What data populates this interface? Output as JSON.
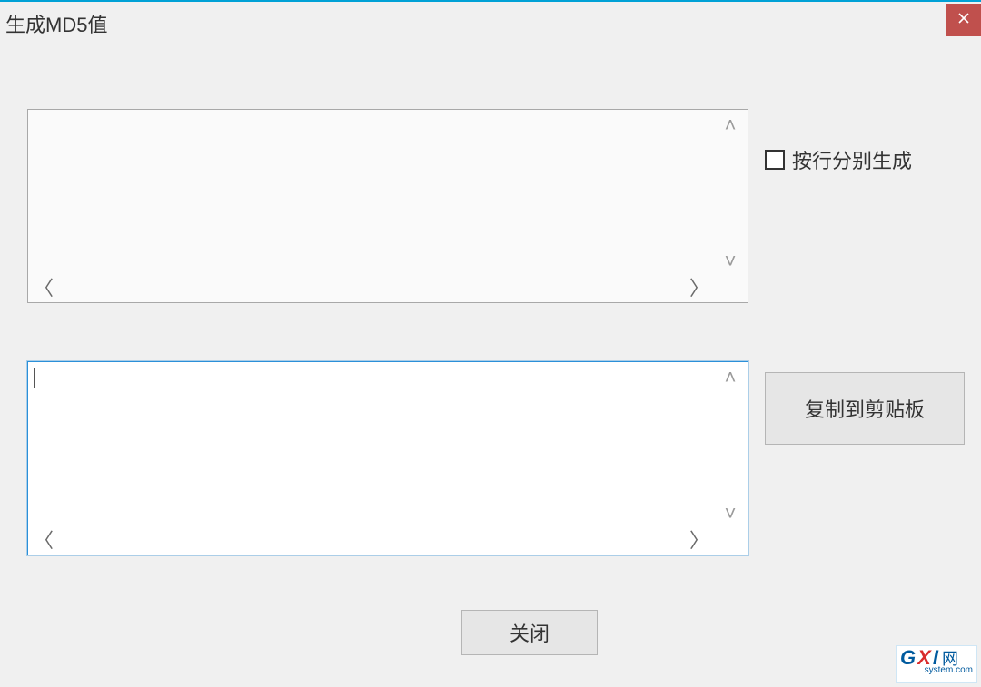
{
  "window": {
    "title": "生成MD5值"
  },
  "options": {
    "per_line_label": "按行分别生成",
    "per_line_checked": false
  },
  "input_text": "",
  "output_text": "",
  "buttons": {
    "copy_label": "复制到剪贴板",
    "close_label": "关闭"
  },
  "watermark": {
    "g": "G",
    "x": "X",
    "i": "I",
    "net": "网",
    "domain": "system.com"
  }
}
